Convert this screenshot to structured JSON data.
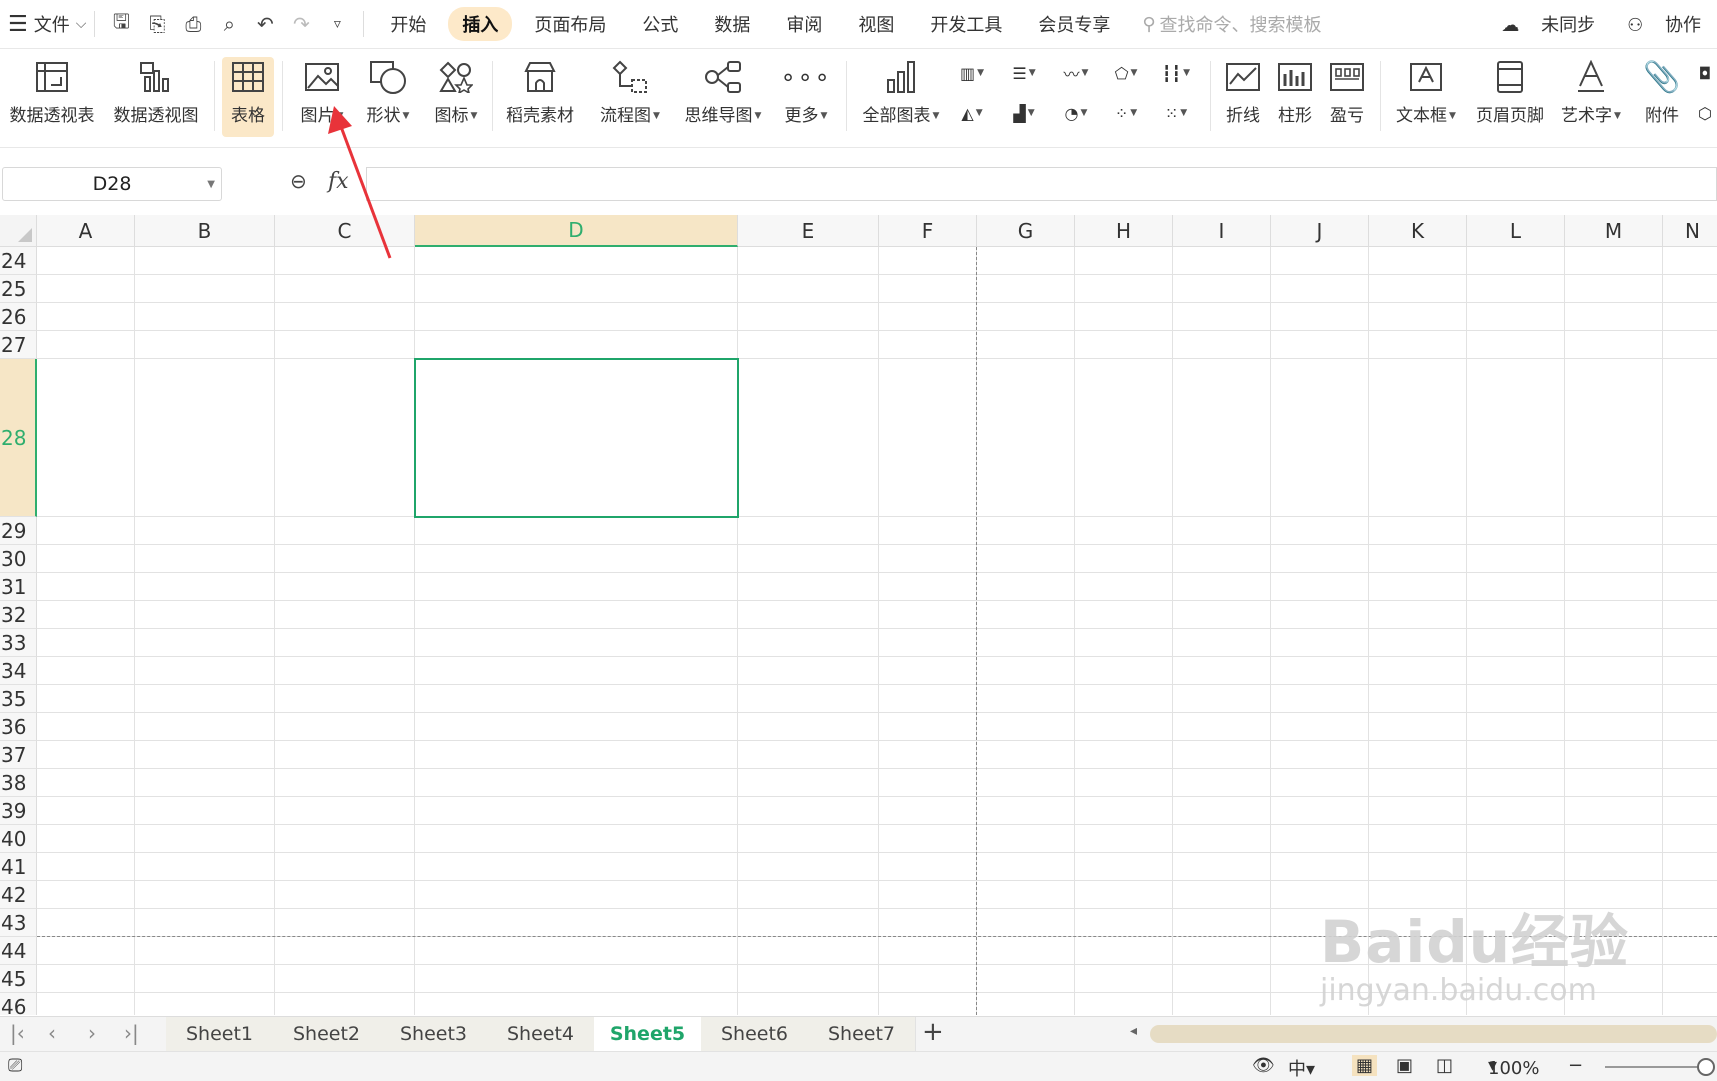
{
  "menubar": {
    "file_label": "文件",
    "tabs": [
      "开始",
      "插入",
      "页面布局",
      "公式",
      "数据",
      "审阅",
      "视图",
      "开发工具",
      "会员专享"
    ],
    "active_tab": "插入",
    "search_placeholder": "查找命令、搜索模板",
    "sync_label": "未同步",
    "collab_label": "协作"
  },
  "ribbon": {
    "pivot_table": "数据透视表",
    "pivot_chart": "数据透视图",
    "table": "表格",
    "picture": "图片",
    "shapes": "形状",
    "icons": "图标",
    "daoke": "稻壳素材",
    "flowchart": "流程图",
    "mindmap": "思维导图",
    "more": "更多",
    "all_charts": "全部图表",
    "line": "折线",
    "column": "柱形",
    "winloss": "盈亏",
    "textbox": "文本框",
    "header_footer": "页眉页脚",
    "wordart": "艺术字",
    "attachment": "附件"
  },
  "formula_bar": {
    "name_box": "D28",
    "fx": "fx",
    "formula": ""
  },
  "grid": {
    "columns": [
      "A",
      "B",
      "C",
      "D",
      "E",
      "F",
      "G",
      "H",
      "I",
      "J",
      "K",
      "L",
      "M",
      "N"
    ],
    "selected_column": "D",
    "rows": [
      "24",
      "25",
      "26",
      "27",
      "28",
      "29",
      "30",
      "31",
      "32",
      "33",
      "34",
      "35",
      "36",
      "37",
      "38",
      "39",
      "40",
      "41",
      "42",
      "43",
      "44",
      "45",
      "46"
    ],
    "selected_row": "28",
    "active_cell": "D28"
  },
  "sheets": {
    "tabs": [
      "Sheet1",
      "Sheet2",
      "Sheet3",
      "Sheet4",
      "Sheet5",
      "Sheet6",
      "Sheet7"
    ],
    "active": "Sheet5"
  },
  "status": {
    "zoom": "100%"
  },
  "watermark": {
    "line1": "Baidu经验",
    "line2": "jingyan.baidu.com"
  },
  "colors": {
    "accent_green": "#1fa56a",
    "active_tab_bg": "#fde9c9",
    "annotation_arrow": "#e8333a"
  }
}
